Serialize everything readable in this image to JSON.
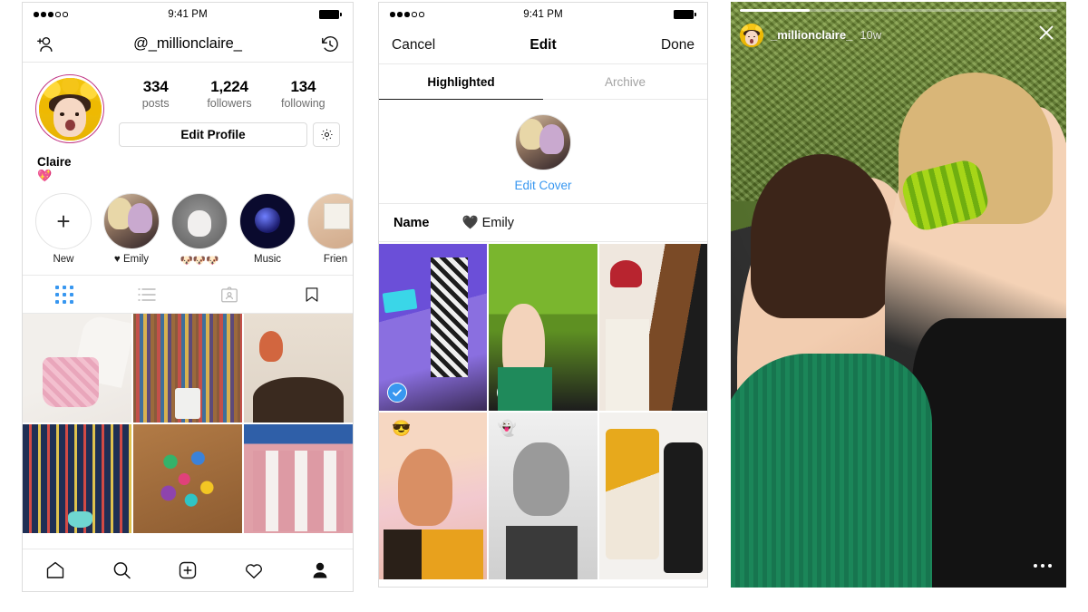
{
  "statusbar": {
    "time": "9:41 PM",
    "signal_dots": 5,
    "signal_filled": 3
  },
  "profile_screen": {
    "header": {
      "handle": "@_millionclaire_",
      "add_person_icon": "add-person-icon",
      "history_icon": "archive-clock-icon"
    },
    "stats": [
      {
        "value": "334",
        "label": "posts"
      },
      {
        "value": "1,224",
        "label": "followers"
      },
      {
        "value": "134",
        "label": "following"
      }
    ],
    "edit_profile_label": "Edit Profile",
    "gear_icon": "gear-icon",
    "bio": {
      "name": "Claire",
      "emoji": "💖"
    },
    "highlights": [
      {
        "label": "New",
        "type": "new",
        "icon": "plus-icon"
      },
      {
        "label": "♥ Emily",
        "type": "cover-emily"
      },
      {
        "label": "🐶🐶🐶",
        "type": "cover-dog"
      },
      {
        "label": "Music",
        "type": "cover-music"
      },
      {
        "label": "Frien",
        "type": "cover-friends"
      }
    ],
    "tabs": [
      {
        "name": "grid-tab",
        "icon": "grid-icon",
        "active": true
      },
      {
        "name": "list-tab",
        "icon": "list-icon",
        "active": false
      },
      {
        "name": "tagged-tab",
        "icon": "tagged-person-icon",
        "active": false
      },
      {
        "name": "saved-tab",
        "icon": "bookmark-icon",
        "active": false
      }
    ],
    "posts": [
      {
        "alt": "pink beaded handbag",
        "cls": "p-bag"
      },
      {
        "alt": "bookshelf wall with stool",
        "cls": "p-books"
      },
      {
        "alt": "mermaid wall art above girl",
        "cls": "p-merm"
      },
      {
        "alt": "striped stairs with sneakers",
        "cls": "p-stairs"
      },
      {
        "alt": "colorful origami cranes on wood",
        "cls": "p-origami"
      },
      {
        "alt": "pink building with fire escape",
        "cls": "p-house"
      }
    ],
    "bottom_nav": [
      {
        "name": "home-tab",
        "icon": "home-icon",
        "active": false
      },
      {
        "name": "search-tab",
        "icon": "search-icon",
        "active": false
      },
      {
        "name": "create-tab",
        "icon": "plus-square-icon",
        "active": false
      },
      {
        "name": "activity-tab",
        "icon": "heart-icon",
        "active": false
      },
      {
        "name": "profile-tab",
        "icon": "person-icon",
        "active": true
      }
    ]
  },
  "edit_screen": {
    "nav": {
      "cancel": "Cancel",
      "title": "Edit",
      "done": "Done"
    },
    "tabs": [
      {
        "label": "Highlighted",
        "active": true
      },
      {
        "label": "Archive",
        "active": false
      }
    ],
    "edit_cover_label": "Edit Cover",
    "name_field": {
      "label": "Name",
      "value": "🖤 Emily"
    },
    "stories": [
      {
        "alt": "girls dancing in neon lit room",
        "cls": "s1",
        "selected": true,
        "badge": ""
      },
      {
        "alt": "two girls lying on green moss with toy caterpillar",
        "cls": "s2",
        "selected": true,
        "badge": ""
      },
      {
        "alt": "girl in red beret and friend by door",
        "cls": "s3",
        "selected": true,
        "badge": ""
      },
      {
        "alt": "girl with sunglasses emoji filter",
        "cls": "s4",
        "selected": false,
        "badge": "😎"
      },
      {
        "alt": "girl with ghost filter sticking tongue out",
        "cls": "s5",
        "selected": false,
        "badge": "👻"
      },
      {
        "alt": "yellow sneakers and black boots on patterned blanket",
        "cls": "s6",
        "selected": false,
        "badge": ""
      }
    ]
  },
  "story_screen": {
    "progress_percent": 22,
    "username": "_millionclaire_",
    "timestamp": "10w",
    "close_icon": "close-icon",
    "more_icon": "more-options-icon",
    "alt": "two girls lying on green moss grass, one holding a green toy caterpillar"
  },
  "colors": {
    "accent_blue": "#3897f0",
    "ring_pink": "#c13584",
    "text_primary": "#000000",
    "text_muted": "#8e8e8e",
    "divider": "#e9e9e9"
  }
}
